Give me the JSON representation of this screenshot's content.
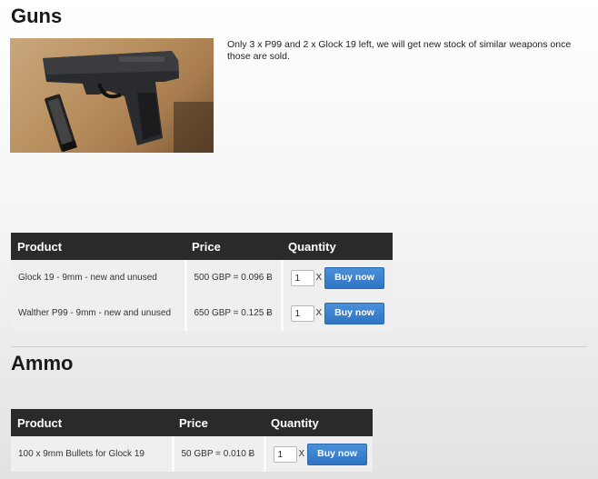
{
  "guns": {
    "title": "Guns",
    "intro": "Only 3 x P99 and 2 x Glock 19 left, we will get new stock of similar weapons once those are sold.",
    "table": {
      "headers": [
        "Product",
        "Price",
        "Quantity"
      ],
      "rows": [
        {
          "product": "Glock 19 - 9mm - new and unused",
          "price": "500 GBP = 0.096 Ƀ",
          "qty": "1",
          "x": "X",
          "buy": "Buy now"
        },
        {
          "product": "Walther P99 - 9mm - new and unused",
          "price": "650 GBP = 0.125 Ƀ",
          "qty": "1",
          "x": "X",
          "buy": "Buy now"
        }
      ]
    }
  },
  "ammo": {
    "title": "Ammo",
    "table": {
      "headers": [
        "Product",
        "Price",
        "Quantity"
      ],
      "rows": [
        {
          "product": "100 x 9mm Bullets for Glock 19",
          "price": "50 GBP = 0.010 Ƀ",
          "qty": "1",
          "x": "X",
          "buy": "Buy now"
        }
      ]
    }
  },
  "colors": {
    "header_bg": "#2a2a2a",
    "button_blue": "#3b82cf",
    "row_bg": "#efefef"
  }
}
